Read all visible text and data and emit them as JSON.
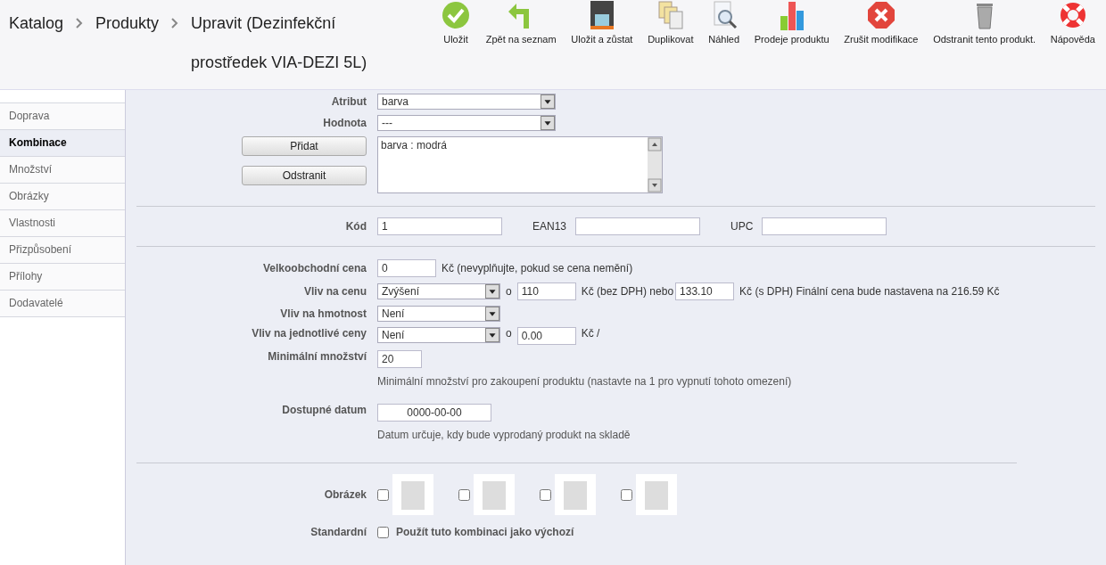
{
  "breadcrumb": [
    "Katalog",
    "Produkty",
    "Upravit (Dezinfekční prostředek VIA-DEZI 5L)"
  ],
  "toolbar": [
    {
      "kind": "check",
      "label": "Uložit"
    },
    {
      "kind": "back",
      "label": "Zpět na seznam"
    },
    {
      "kind": "save",
      "label": "Uložit a zůstat"
    },
    {
      "kind": "duplicate",
      "label": "Duplikovat"
    },
    {
      "kind": "preview",
      "label": "Náhled"
    },
    {
      "kind": "chart",
      "label": "Prodeje produktu"
    },
    {
      "kind": "cancel",
      "label": "Zrušit modifikace"
    },
    {
      "kind": "trash",
      "label": "Odstranit tento produkt."
    },
    {
      "kind": "help",
      "label": "Nápověda"
    }
  ],
  "sidebar": {
    "items": [
      {
        "label": "Doprava",
        "selected": false
      },
      {
        "label": "Kombinace",
        "selected": true
      },
      {
        "label": "Množství",
        "selected": false
      },
      {
        "label": "Obrázky",
        "selected": false
      },
      {
        "label": "Vlastnosti",
        "selected": false
      },
      {
        "label": "Přizpůsobení",
        "selected": false
      },
      {
        "label": "Přílohy",
        "selected": false
      },
      {
        "label": "Dodavatelé",
        "selected": false
      }
    ]
  },
  "attribute": {
    "label": "Atribut",
    "value": "barva"
  },
  "attribute_value": {
    "label": "Hodnota",
    "value": "---"
  },
  "attribute_buttons": [
    "Přidat",
    "Odstranit"
  ],
  "attribute_list": [
    "barva : modrá"
  ],
  "codes": [
    {
      "label": "Kód",
      "value": "1"
    },
    {
      "label": "EAN13"
    },
    {
      "label": "UPC"
    }
  ],
  "wholesale": {
    "label": "Velkoobchodní cena",
    "value": "0",
    "note": "Kč (nevyplňujte, pokud se cena nemění)"
  },
  "price_impact": {
    "label": "Vliv na cenu",
    "select": "Zvýšení",
    "o": "o",
    "amount": "110",
    "unit1": "Kč (bez DPH) nebo",
    "amount_tax": "133.10",
    "unit2": "Kč (s DPH) Finální cena bude nastavena na 216.59 Kč"
  },
  "weight_impact": {
    "label": "Vliv na hmotnost",
    "select": "Není"
  },
  "unit_impact": {
    "label": "Vliv na jednotlivé ceny",
    "select": "Není",
    "o": "o",
    "amount": "0.00",
    "unit": "Kč /"
  },
  "min_quantity": {
    "label": "Minimální množství",
    "value": "20",
    "help": "Minimální množství pro zakoupení produktu (nastavte na 1 pro vypnutí tohoto omezení)"
  },
  "available_date": {
    "label": "Dostupné datum",
    "value": "0000-00-00",
    "help": "Datum určuje, kdy bude vyprodaný produkt na skladě"
  },
  "images": {
    "label": "Obrázek",
    "items": [
      {
        "checked": false
      },
      {
        "checked": false
      },
      {
        "checked": false
      },
      {
        "checked": false
      }
    ]
  },
  "default": {
    "label": "Standardní",
    "text": "Použít tuto kombinaci jako výchozí",
    "checked": false
  }
}
